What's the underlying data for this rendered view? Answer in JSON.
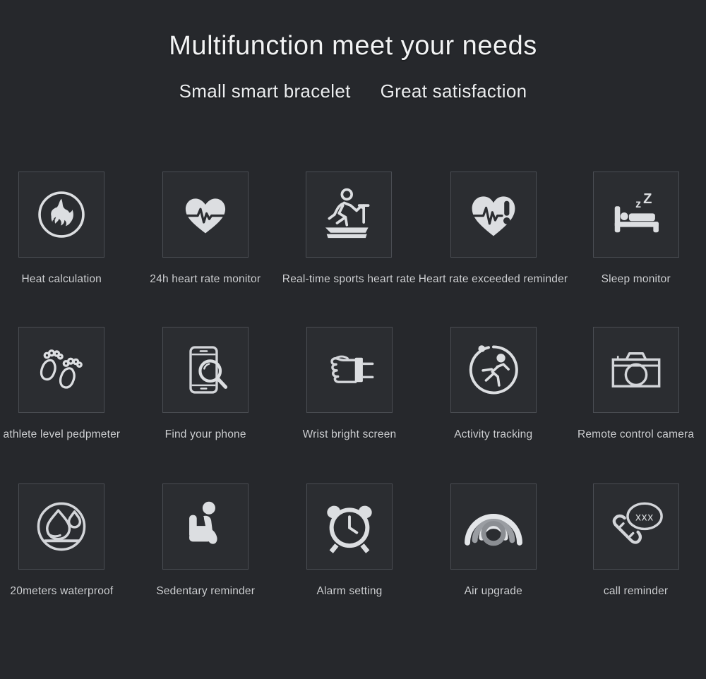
{
  "header": {
    "title": "Multifunction meet your needs",
    "subtitle_left": "Small smart bracelet",
    "subtitle_right": "Great satisfaction"
  },
  "theme": {
    "background": "#26282c",
    "tile_background": "#2b2d31",
    "tile_border": "#4a4d53",
    "icon_color": "#dcdee1",
    "title_color": "#f2f3f4",
    "label_color": "#cfd1d4"
  },
  "features": {
    "rows": [
      [
        {
          "label": "Heat calculation",
          "icon": "flame-circle-icon"
        },
        {
          "label": "24h heart rate monitor",
          "icon": "heart-pulse-icon"
        },
        {
          "label": "Real-time sports heart rate",
          "icon": "treadmill-runner-icon"
        },
        {
          "label": "Heart rate exceeded reminder",
          "icon": "heart-alert-icon"
        },
        {
          "label": "Sleep monitor",
          "icon": "bed-sleep-icon"
        }
      ],
      [
        {
          "label": "athlete level pedpmeter",
          "icon": "footprints-icon"
        },
        {
          "label": "Find your phone",
          "icon": "phone-search-icon"
        },
        {
          "label": "Wrist bright screen",
          "icon": "wrist-band-icon"
        },
        {
          "label": "Activity tracking",
          "icon": "runner-circle-icon"
        },
        {
          "label": "Remote control camera",
          "icon": "camera-icon"
        }
      ],
      [
        {
          "label": "20meters waterproof",
          "icon": "water-drop-circle-icon"
        },
        {
          "label": "Sedentary reminder",
          "icon": "seated-person-icon"
        },
        {
          "label": "Alarm setting",
          "icon": "alarm-clock-icon"
        },
        {
          "label": "Air upgrade",
          "icon": "wireless-waves-icon"
        },
        {
          "label": "call reminder",
          "icon": "phone-call-bubble-icon"
        }
      ]
    ]
  }
}
